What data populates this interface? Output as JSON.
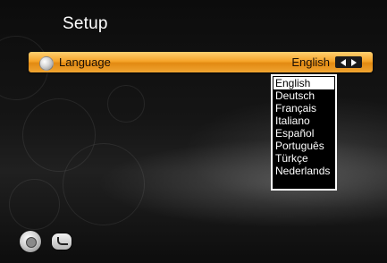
{
  "header": {
    "title": "Setup"
  },
  "setting_row": {
    "label": "Language",
    "value": "English",
    "icon": "globe-icon",
    "nav_icon": "left-right-icon"
  },
  "language_dropdown": {
    "selected": "English",
    "options": [
      "English",
      "Deutsch",
      "Français",
      "Italiano",
      "Español",
      "Português",
      "Türkçe",
      "Nederlands"
    ]
  },
  "footer": {
    "icons": [
      "navigation-pad-icon",
      "back-icon"
    ]
  },
  "colors": {
    "highlight_bar": "#f6a52a",
    "text_on_highlight": "#1b1006",
    "dropdown_border": "#ffffff",
    "dropdown_selected_bg": "#ffffff"
  }
}
